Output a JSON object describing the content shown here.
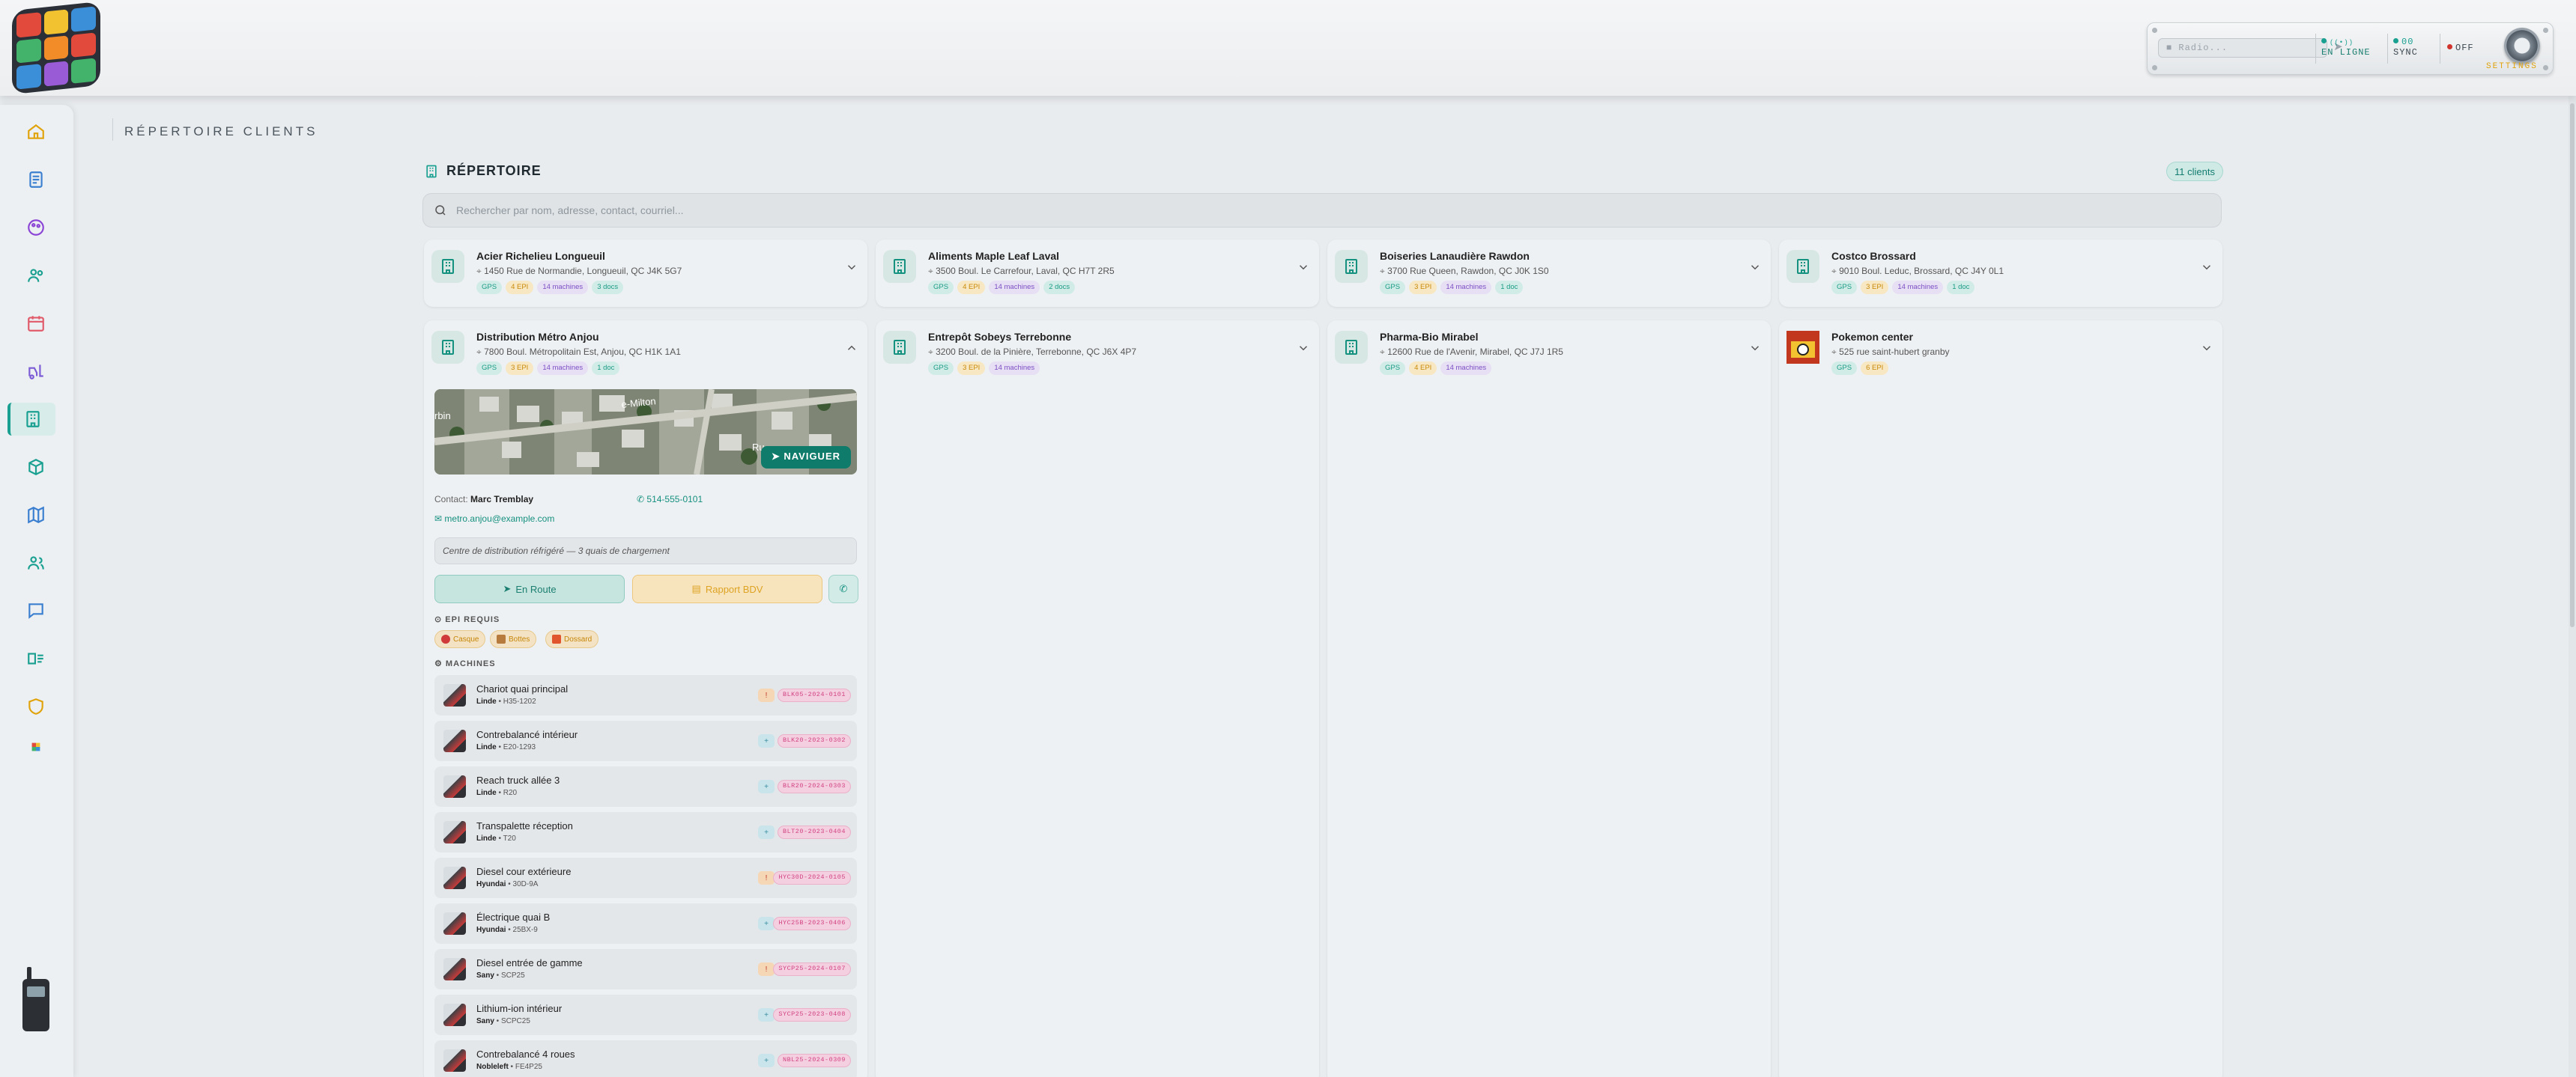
{
  "app": {
    "page_title": "RÉPERTOIRE CLIENTS"
  },
  "panel": {
    "radio_placeholder": "Radio...",
    "online_label": "EN LIGNE",
    "sync_count": "00",
    "sync_label": "SYNC",
    "off_label": "OFF",
    "settings_label": "SETTINGS"
  },
  "directory": {
    "title": "RÉPERTOIRE",
    "count": "11 clients",
    "search_placeholder": "Rechercher par nom, adresse, contact, courriel..."
  },
  "clients": [
    {
      "name": "Acier Richelieu Longueuil",
      "address": "1450 Rue de Normandie, Longueuil, QC J4K 5G7",
      "tags": [
        "GPS",
        "4 EPI",
        "14 machines",
        "3 docs"
      ]
    },
    {
      "name": "Aliments Maple Leaf Laval",
      "address": "3500 Boul. Le Carrefour, Laval, QC H7T 2R5",
      "tags": [
        "GPS",
        "4 EPI",
        "14 machines",
        "2 docs"
      ]
    },
    {
      "name": "Boiseries Lanaudière Rawdon",
      "address": "3700 Rue Queen, Rawdon, QC J0K 1S0",
      "tags": [
        "GPS",
        "3 EPI",
        "14 machines",
        "1 doc"
      ]
    },
    {
      "name": "Costco Brossard",
      "address": "9010 Boul. Leduc, Brossard, QC J4Y 0L1",
      "tags": [
        "GPS",
        "3 EPI",
        "14 machines",
        "1 doc"
      ]
    },
    {
      "name": "Distribution Métro Anjou",
      "address": "7800 Boul. Métropolitain Est, Anjou, QC H1K 1A1",
      "tags": [
        "GPS",
        "3 EPI",
        "14 machines",
        "1 doc"
      ]
    },
    {
      "name": "Entrepôt Sobeys Terrebonne",
      "address": "3200 Boul. de la Pinière, Terrebonne, QC J6X 4P7",
      "tags": [
        "GPS",
        "3 EPI",
        "14 machines"
      ]
    },
    {
      "name": "Pharma-Bio Mirabel",
      "address": "12600 Rue de l'Avenir, Mirabel, QC J7J 1R5",
      "tags": [
        "GPS",
        "4 EPI",
        "14 machines"
      ]
    },
    {
      "name": "Pokemon center",
      "address": "525 rue saint-hubert granby",
      "tags": [
        "GPS",
        "6 EPI"
      ]
    }
  ],
  "expanded": {
    "navigate_label": "NAVIGUER",
    "map_street_1": "rbin",
    "map_street_2": "e-Milton",
    "map_street_3": "Ru",
    "contact_label": "Contact:",
    "contact_name": "Marc Tremblay",
    "phone": "514-555-0101",
    "email": "metro.anjou@example.com",
    "note": "Centre de distribution réfrigéré — 3 quais de chargement",
    "route_label": "En Route",
    "report_label": "Rapport BDV",
    "epi_title": "EPI REQUIS",
    "epi": [
      "Casque",
      "Bottes",
      "Dossard"
    ],
    "machines_title": "MACHINES",
    "machines": [
      {
        "name": "Chariot quai principal",
        "brand": "Linde",
        "model": "H35-1202",
        "status": "!",
        "code": "BLK05-2024-0101"
      },
      {
        "name": "Contrebalancé intérieur",
        "brand": "Linde",
        "model": "E20-1293",
        "status": "+",
        "code": "BLK20-2023-0302"
      },
      {
        "name": "Reach truck allée 3",
        "brand": "Linde",
        "model": "R20",
        "status": "+",
        "code": "BLR20-2024-0303"
      },
      {
        "name": "Transpalette réception",
        "brand": "Linde",
        "model": "T20",
        "status": "+",
        "code": "BLT20-2023-0404"
      },
      {
        "name": "Diesel cour extérieure",
        "brand": "Hyundai",
        "model": "30D-9A",
        "status": "!",
        "code": "HYC30D-2024-0105"
      },
      {
        "name": "Électrique quai B",
        "brand": "Hyundai",
        "model": "25BX-9",
        "status": "+",
        "code": "HYC25B-2023-0406"
      },
      {
        "name": "Diesel entrée de gamme",
        "brand": "Sany",
        "model": "SCP25",
        "status": "!",
        "code": "SYCP25-2024-0107"
      },
      {
        "name": "Lithium-ion intérieur",
        "brand": "Sany",
        "model": "SCPC25",
        "status": "+",
        "code": "SYCP25-2023-0408"
      },
      {
        "name": "Contrebalancé 4 roues",
        "brand": "Nobleleft",
        "model": "FE4P25",
        "status": "+",
        "code": "NBL25-2024-0309"
      }
    ]
  },
  "colors": {
    "accent": "#1aa091",
    "warning": "#e0a30c",
    "pink": "#d24484"
  }
}
